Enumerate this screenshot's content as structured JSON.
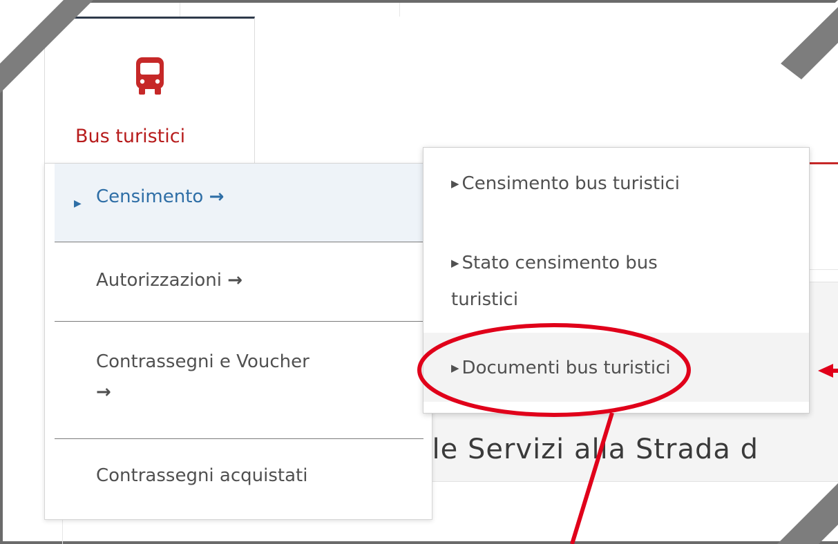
{
  "tab": {
    "label": "Bus turistici",
    "icon": "bus-icon",
    "accent_color": "#b71c1c"
  },
  "menu": {
    "items": [
      {
        "label": "Censimento",
        "arrow": "→",
        "active": true
      },
      {
        "label": "Autorizzazioni",
        "arrow": "→",
        "active": false
      },
      {
        "label": "Contrassegni e Voucher",
        "arrow": "→",
        "active": false
      },
      {
        "label": "Contrassegni acquistati",
        "arrow": "",
        "active": false
      }
    ]
  },
  "submenu": {
    "items": [
      {
        "label": "Censimento bus turistici"
      },
      {
        "label_line1": "Stato censimento bus",
        "label_line2": "turistici"
      },
      {
        "label": "Documenti bus turistici",
        "highlighted": true
      }
    ]
  },
  "background": {
    "partial_text": "ale Servizi alla Strada d"
  },
  "annotation": {
    "color": "#e0001a"
  }
}
